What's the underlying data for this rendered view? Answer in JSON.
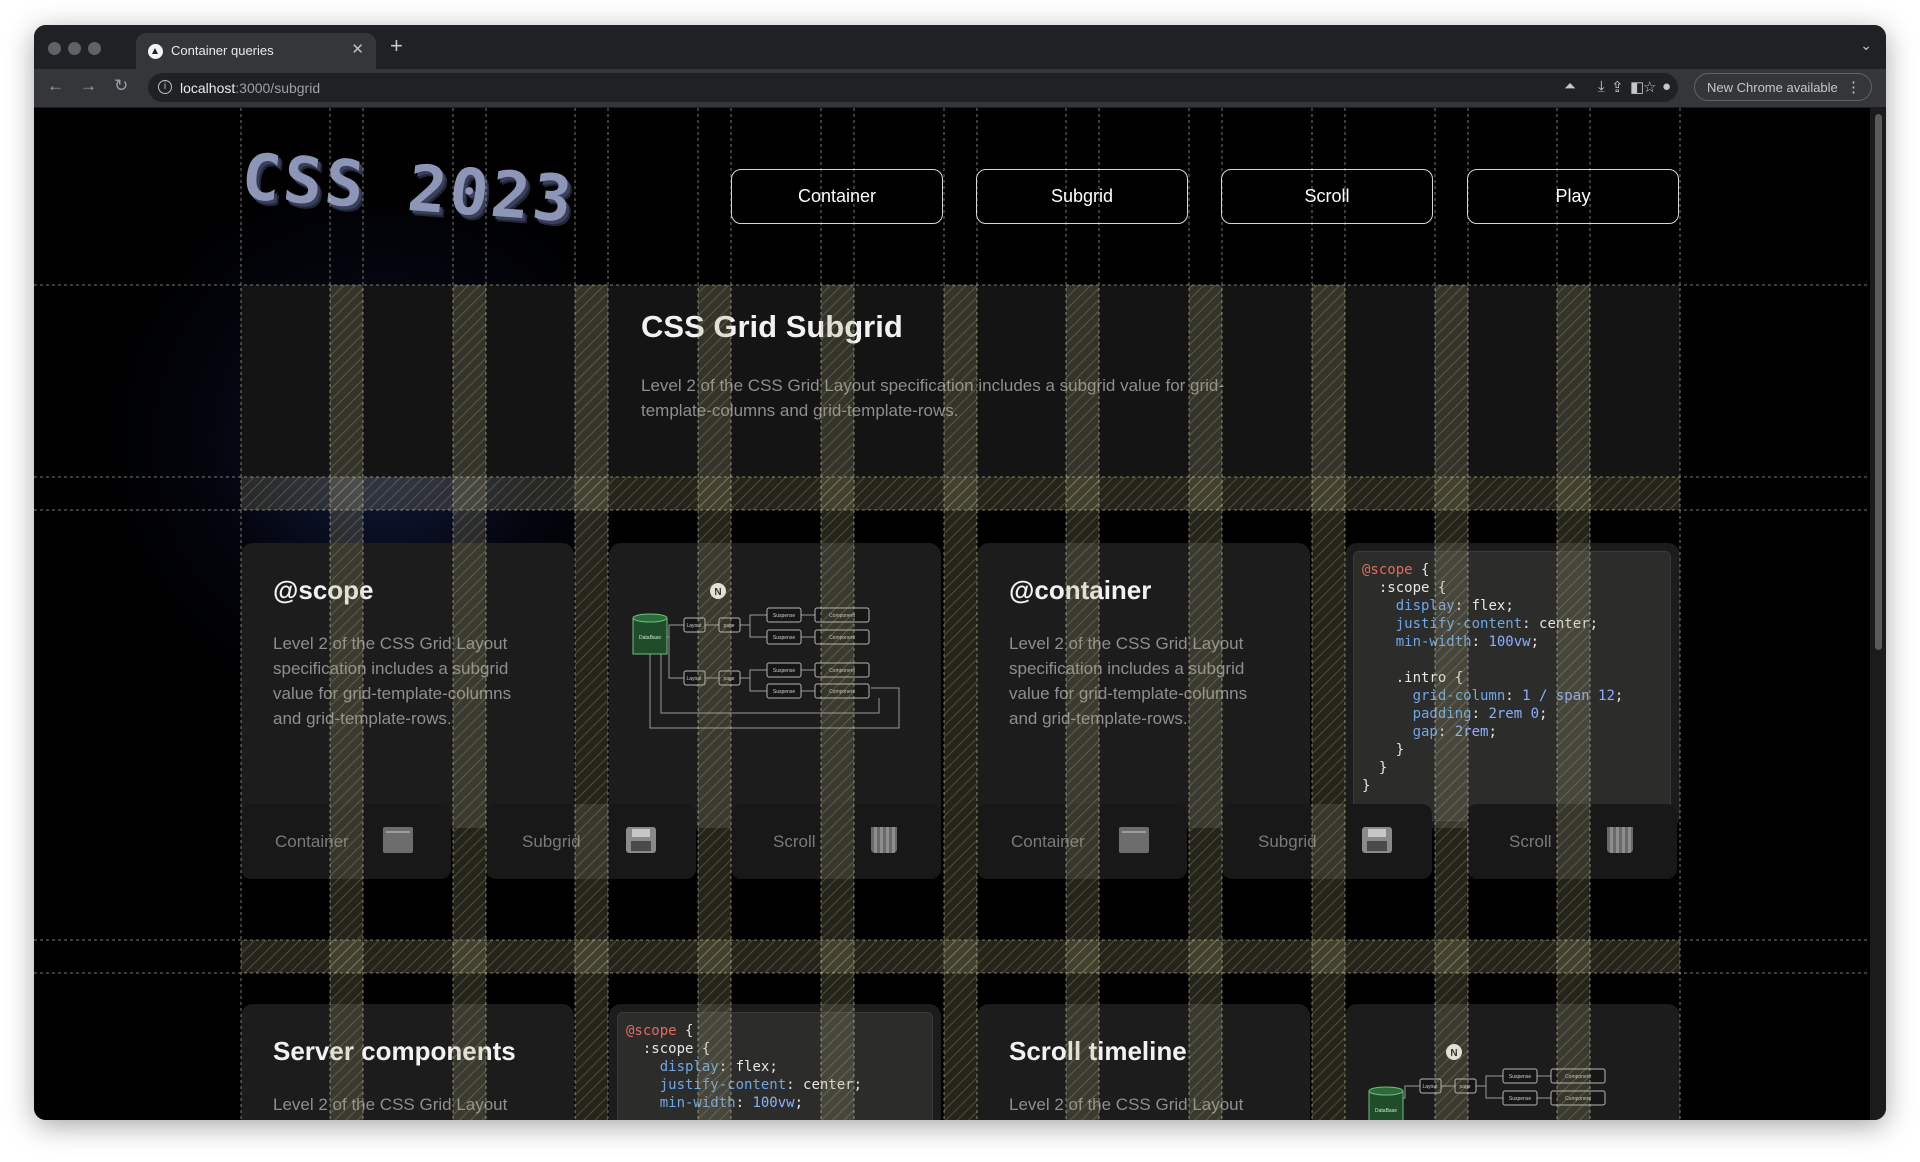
{
  "browser": {
    "tab_title": "Container queries",
    "url_host": "localhost",
    "url_path": ":3000/subgrid",
    "update_label": "New Chrome available"
  },
  "site": {
    "logo_text": "CSS 2023",
    "nav": [
      "Container",
      "Subgrid",
      "Scroll",
      "Play"
    ]
  },
  "hero": {
    "title": "CSS Grid Subgrid",
    "description": "Level 2 of the CSS Grid Layout specification includes a subgrid value for grid-template-columns and grid-template-rows."
  },
  "cards": {
    "scope": {
      "title": "@scope",
      "text": "Level 2 of the CSS Grid Layout specification includes a subgrid value for grid-template-columns and grid-template-rows."
    },
    "container": {
      "title": "@container",
      "text": "Level 2 of the CSS Grid Layout specification includes a subgrid value for grid-template-columns and grid-template-rows."
    },
    "server": {
      "title": "Server components",
      "text": "Level 2 of the CSS Grid Layout"
    },
    "scroll": {
      "title": "Scroll timeline",
      "text": "Level 2 of the CSS Grid Layout"
    }
  },
  "diagram": {
    "badge": "N",
    "db_label": "DataBase",
    "node_labels": [
      "Layout",
      "page",
      "Suspense",
      "Component",
      "Suspense",
      "Component",
      "Layout",
      "page",
      "Suspense",
      "Component",
      "Suspense",
      "Component"
    ]
  },
  "code_snippet": {
    "at_rule": "@scope",
    "selector": ":scope",
    "nested_selector": ".intro",
    "declarations": [
      {
        "prop": "display",
        "value": "flex"
      },
      {
        "prop": "justify-content",
        "value": "center"
      },
      {
        "prop": "min-width",
        "value": "100vw"
      }
    ],
    "nested_declarations": [
      {
        "prop": "grid-column",
        "value": "1 / span 12"
      },
      {
        "prop": "padding",
        "value": "2rem 0"
      },
      {
        "prop": "gap",
        "value": "2rem"
      }
    ]
  },
  "tiles": [
    {
      "label": "Container",
      "icon": "window-icon"
    },
    {
      "label": "Subgrid",
      "icon": "floppy-disk-icon"
    },
    {
      "label": "Scroll",
      "icon": "trash-can-icon"
    },
    {
      "label": "Container",
      "icon": "window-icon"
    },
    {
      "label": "Subgrid",
      "icon": "floppy-disk-icon"
    },
    {
      "label": "Scroll",
      "icon": "trash-can-icon"
    }
  ],
  "colors": {
    "page_bg": "#000000",
    "card_bg": "#1c1c1c",
    "overlay_stripe": "#beb996",
    "code_keyword": "#e06c60",
    "code_property": "#6ea7e8"
  }
}
